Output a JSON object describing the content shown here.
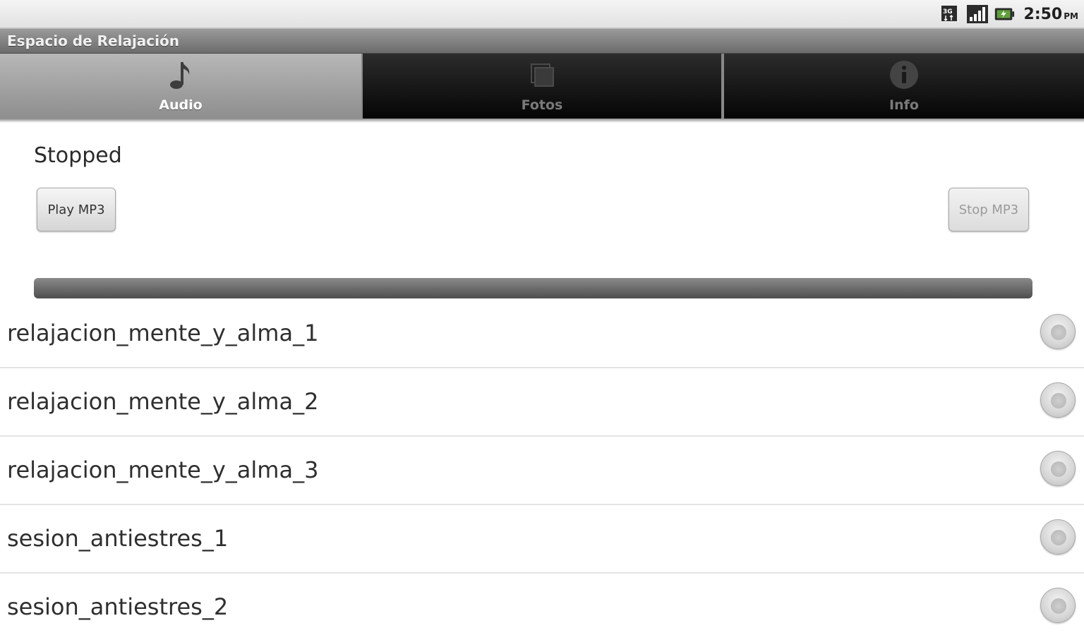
{
  "status_bar": {
    "icons": [
      "3g-data-icon",
      "signal-strength-icon",
      "battery-icon"
    ],
    "time": "2:50",
    "ampm": "PM"
  },
  "app": {
    "title": "Espacio de Relajación"
  },
  "tabs": [
    {
      "label": "Audio",
      "icon": "music-note-icon",
      "active": true
    },
    {
      "label": "Fotos",
      "icon": "photo-gallery-icon",
      "active": false
    },
    {
      "label": "Info",
      "icon": "info-icon",
      "active": false
    }
  ],
  "player": {
    "status": "Stopped",
    "play_label": "Play MP3",
    "stop_label": "Stop MP3",
    "stop_enabled": false,
    "progress": 0
  },
  "tracks": [
    {
      "name": "relajacion_mente_y_alma_1",
      "selected": false
    },
    {
      "name": "relajacion_mente_y_alma_2",
      "selected": false
    },
    {
      "name": "relajacion_mente_y_alma_3",
      "selected": false
    },
    {
      "name": "sesion_antiestres_1",
      "selected": false
    },
    {
      "name": "sesion_antiestres_2",
      "selected": false
    }
  ]
}
